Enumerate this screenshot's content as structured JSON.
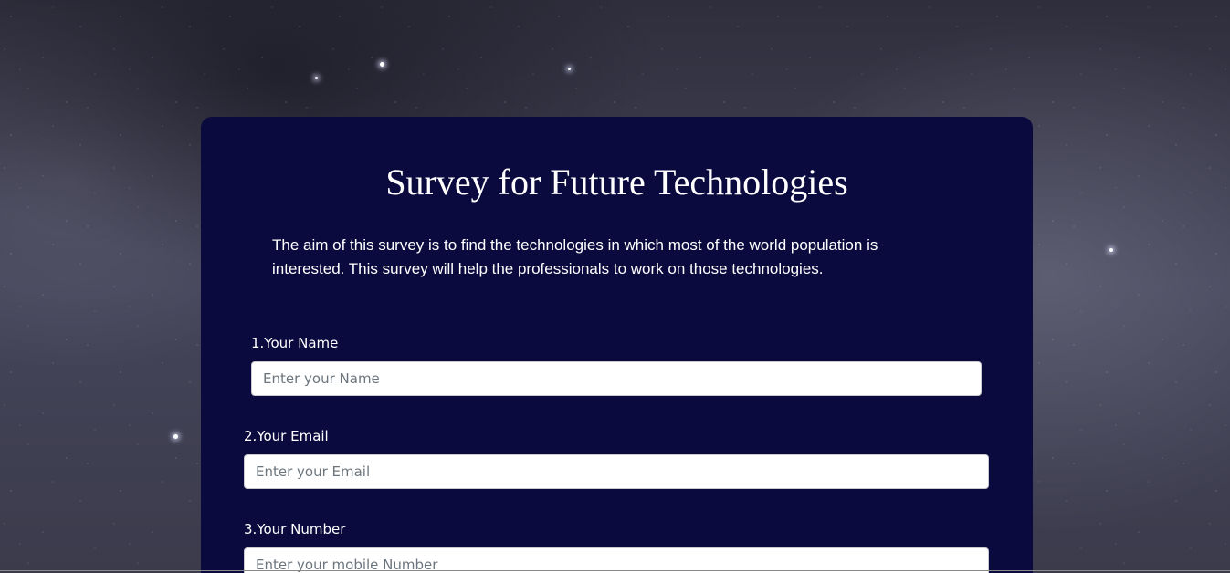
{
  "survey": {
    "title": "Survey for Future Technologies",
    "description": "The aim of this survey is to find the technologies in which most of the world population is interested. This survey will help the professionals to work on those technologies.",
    "fields": {
      "name": {
        "label": "1.Your Name",
        "placeholder": "Enter your Name",
        "value": ""
      },
      "email": {
        "label": "2.Your Email",
        "placeholder": "Enter your Email",
        "value": ""
      },
      "number": {
        "label": "3.Your Number",
        "placeholder": "Enter your mobile Number",
        "value": ""
      }
    }
  },
  "colors": {
    "card_background": "#0b0a3e",
    "text": "#ffffff",
    "input_background": "#ffffff"
  }
}
